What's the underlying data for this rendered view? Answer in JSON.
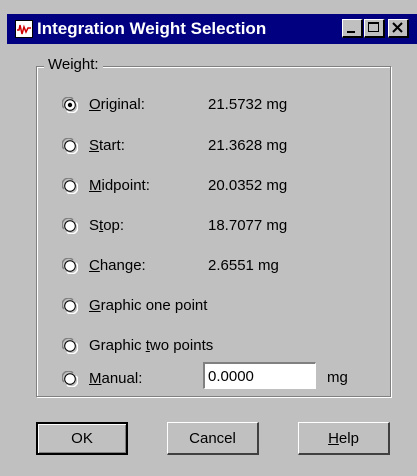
{
  "window": {
    "title": "Integration Weight Selection",
    "icon": "waveform-icon",
    "controls": [
      "minimize",
      "maximize",
      "close"
    ]
  },
  "group": {
    "label": "Weight:"
  },
  "options": [
    {
      "label": "Original:",
      "mnemonic": "O",
      "value": "21.5732  mg",
      "selected": true
    },
    {
      "label": "Start:",
      "mnemonic": "S",
      "value": "21.3628  mg",
      "selected": false
    },
    {
      "label": "Midpoint:",
      "mnemonic": "M",
      "value": "20.0352  mg",
      "selected": false
    },
    {
      "label": "Stop:",
      "mnemonic": "t",
      "value": "18.7077  mg",
      "selected": false
    },
    {
      "label": "Change:",
      "mnemonic": "C",
      "value": "2.6551  mg",
      "selected": false
    },
    {
      "label": "Graphic one point",
      "mnemonic": "G",
      "value": "",
      "selected": false
    },
    {
      "label": "Graphic two points",
      "mnemonic": "t",
      "value": "",
      "selected": false
    },
    {
      "label": "Manual:",
      "mnemonic": "M",
      "value": "",
      "selected": false
    }
  ],
  "manual": {
    "value": "0.0000",
    "unit": "mg"
  },
  "buttons": {
    "ok": "OK",
    "cancel": "Cancel",
    "help": "Help",
    "help_mnemonic": "H"
  },
  "colors": {
    "titlebar": "#000080",
    "face": "#c0c0c0"
  }
}
